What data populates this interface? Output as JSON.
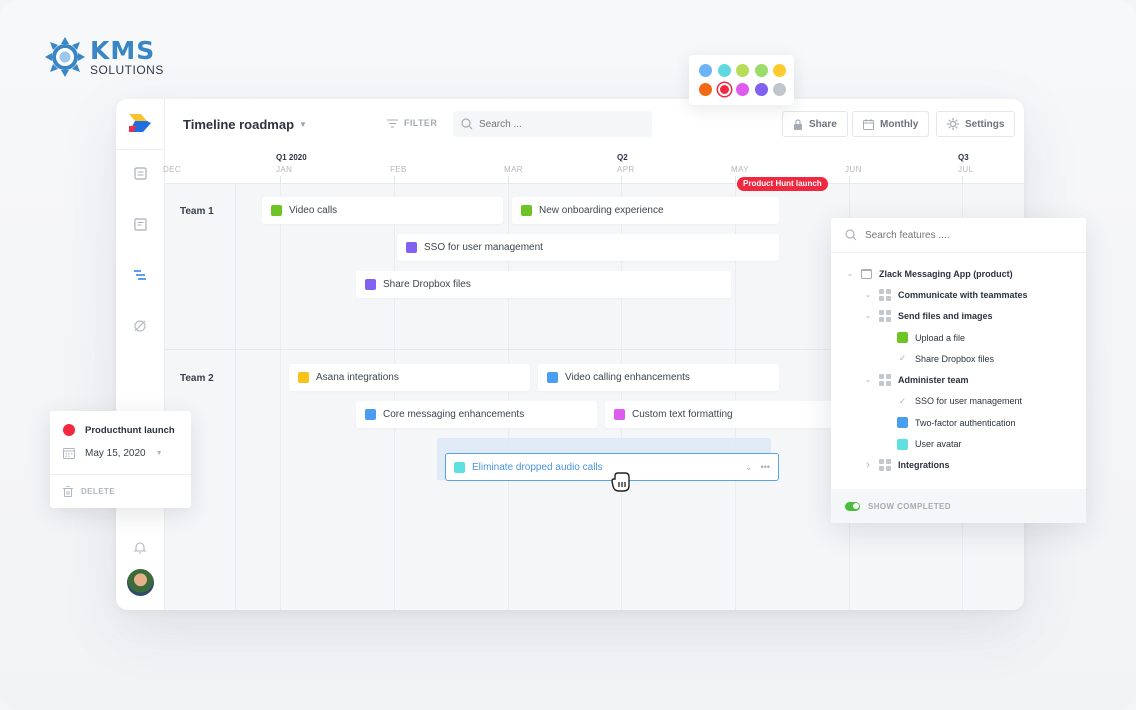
{
  "brand": {
    "name": "KMS",
    "subtitle": "SOLUTIONS"
  },
  "app": {
    "title": "Timeline roadmap",
    "filter_label": "FILTER",
    "search_placeholder": "Search ...",
    "buttons": {
      "share": "Share",
      "monthly": "Monthly",
      "settings": "Settings"
    },
    "rail_icons": [
      "inbox-icon",
      "document-icon",
      "roadmap-icon",
      "hidden-icon",
      "bell-icon"
    ]
  },
  "timeline": {
    "quarters": [
      {
        "label": "Q1 2020"
      },
      {
        "label": "Q2"
      },
      {
        "label": "Q3"
      }
    ],
    "months": [
      "DEC",
      "JAN",
      "FEB",
      "MAR",
      "APR",
      "MAY",
      "JUN",
      "JUL"
    ],
    "milestone": {
      "label": "Product Hunt launch",
      "color": "#f02840"
    }
  },
  "teams": [
    {
      "name": "Team 1",
      "items": [
        {
          "label": "Video calls",
          "color": "#6cc524"
        },
        {
          "label": "New onboarding experience",
          "color": "#6cc524"
        },
        {
          "label": "SSO for user management",
          "color": "#8160f2"
        },
        {
          "label": "Share Dropbox files",
          "color": "#8160f2"
        }
      ]
    },
    {
      "name": "Team 2",
      "items": [
        {
          "label": "Asana integrations",
          "color": "#fbc21a"
        },
        {
          "label": "Video calling enhancements",
          "color": "#4a9ef2"
        },
        {
          "label": "Core messaging enhancements",
          "color": "#4a9ef2"
        },
        {
          "label": "Custom text formatting",
          "color": "#dd5bef"
        },
        {
          "label": "Eliminate dropped audio calls",
          "color": "#5ee0e0",
          "state": "dragging"
        }
      ]
    }
  ],
  "palette": {
    "colors": [
      "#6db3f8",
      "#5fd8e0",
      "#b7dd58",
      "#9bdc6a",
      "#fdcb2f",
      "#f26a13",
      "#f02840",
      "#dd5bef",
      "#8160f2",
      "#c1c6cd"
    ],
    "selected_index": 6
  },
  "feature_panel": {
    "search_placeholder": "Search features ....",
    "tree": [
      {
        "label": "Zlack Messaging App (product)",
        "type": "product",
        "expanded": true,
        "level": 0
      },
      {
        "label": "Communicate with teammates",
        "type": "group",
        "expanded": true,
        "level": 1
      },
      {
        "label": "Send files and images",
        "type": "group",
        "expanded": true,
        "level": 1
      },
      {
        "label": "Upload a file",
        "type": "feature",
        "color": "#6cc524",
        "level": 2
      },
      {
        "label": "Share Dropbox files",
        "type": "completed",
        "level": 2
      },
      {
        "label": "Administer team",
        "type": "group",
        "expanded": true,
        "level": 1
      },
      {
        "label": "SSO for user management",
        "type": "completed",
        "level": 2
      },
      {
        "label": "Two-factor authentication",
        "type": "feature",
        "color": "#4a9ef2",
        "level": 2
      },
      {
        "label": "User avatar",
        "type": "feature",
        "color": "#5ee0e0",
        "level": 2
      },
      {
        "label": "Integrations",
        "type": "group",
        "expanded": false,
        "level": 1
      }
    ],
    "show_completed_label": "SHOW COMPLETED",
    "show_completed": true
  },
  "milestone_card": {
    "title": "Producthunt launch",
    "date": "May 15, 2020",
    "delete_label": "DELETE",
    "color": "#f02840"
  },
  "fab_label": "+"
}
